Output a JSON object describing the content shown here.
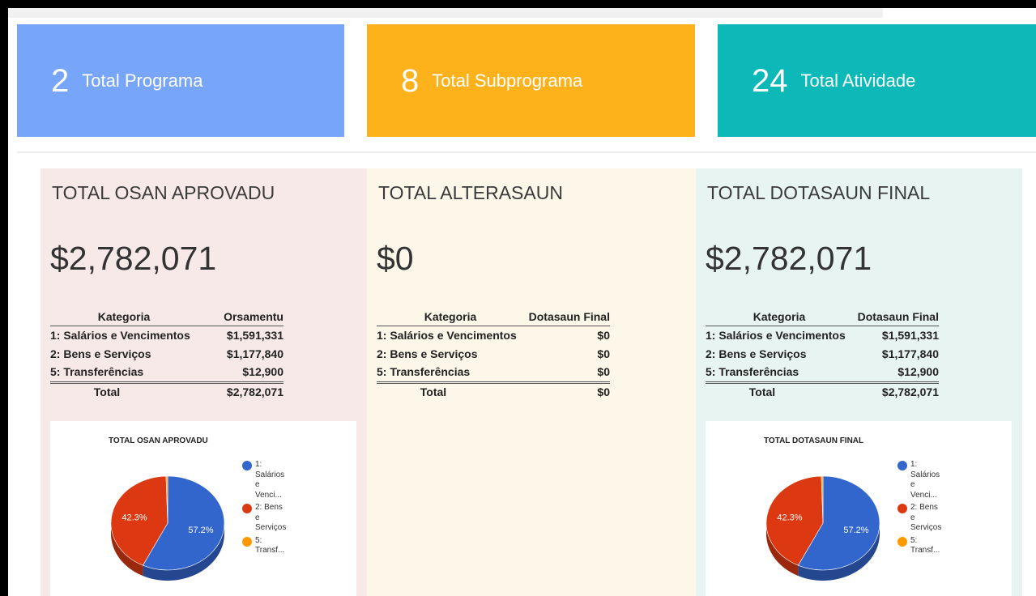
{
  "stats": [
    {
      "value": "2",
      "label": "Total Programa",
      "color": "#77a5fa"
    },
    {
      "value": "8",
      "label": "Total Subprograma",
      "color": "#fdb21c"
    },
    {
      "value": "24",
      "label": "Total Atividade",
      "color": "#0cb8b8"
    }
  ],
  "panels": [
    {
      "title": "TOTAL OSAN APROVADU",
      "amount": "$2,782,071",
      "table": {
        "headers": [
          "Kategoria",
          "Orsamentu"
        ],
        "rows": [
          [
            "1: Salários e Vencimentos",
            "$1,591,331"
          ],
          [
            "2: Bens e Serviços",
            "$1,177,840"
          ],
          [
            "5: Transferências",
            "$12,900"
          ]
        ],
        "total": [
          "Total",
          "$2,782,071"
        ]
      }
    },
    {
      "title": "TOTAL ALTERASAUN",
      "amount": "$0",
      "table": {
        "headers": [
          "Kategoria",
          "Dotasaun Final"
        ],
        "rows": [
          [
            "1: Salários e Vencimentos",
            "$0"
          ],
          [
            "2: Bens e Serviços",
            "$0"
          ],
          [
            "5: Transferências",
            "$0"
          ]
        ],
        "total": [
          "Total",
          "$0"
        ]
      }
    },
    {
      "title": "TOTAL DOTASAUN FINAL",
      "amount": "$2,782,071",
      "table": {
        "headers": [
          "Kategoria",
          "Dotasaun Final"
        ],
        "rows": [
          [
            "1: Salários e Vencimentos",
            "$1,591,331"
          ],
          [
            "2: Bens e Serviços",
            "$1,177,840"
          ],
          [
            "5: Transferências",
            "$12,900"
          ]
        ],
        "total": [
          "Total",
          "$2,782,071"
        ]
      }
    }
  ],
  "chart_data": [
    {
      "type": "pie",
      "title": "TOTAL OSAN APROVADU",
      "categories": [
        "1: Salários e Vencimentos",
        "2: Bens e Serviços",
        "5: Transferências"
      ],
      "values": [
        1591331,
        1177840,
        12900
      ],
      "slice_labels": [
        "57.2%",
        "42.3%",
        ""
      ],
      "legend_lines": [
        [
          "1:",
          "Salários",
          "e",
          "Venci..."
        ],
        [
          "2: Bens",
          "e",
          "Serviços"
        ],
        [
          "5:",
          "Transf..."
        ]
      ],
      "colors": [
        "#3366cc",
        "#dc3912",
        "#ff9900"
      ],
      "legend": "right",
      "style": "3d"
    },
    {
      "type": "pie",
      "title": "TOTAL DOTASAUN FINAL",
      "categories": [
        "1: Salários e Vencimentos",
        "2: Bens e Serviços",
        "5: Transferências"
      ],
      "values": [
        1591331,
        1177840,
        12900
      ],
      "slice_labels": [
        "57.2%",
        "42.3%",
        ""
      ],
      "legend_lines": [
        [
          "1:",
          "Salários",
          "e",
          "Venci..."
        ],
        [
          "2: Bens",
          "e",
          "Serviços"
        ],
        [
          "5:",
          "Transf..."
        ]
      ],
      "colors": [
        "#3366cc",
        "#dc3912",
        "#ff9900"
      ],
      "legend": "right",
      "style": "3d"
    }
  ]
}
